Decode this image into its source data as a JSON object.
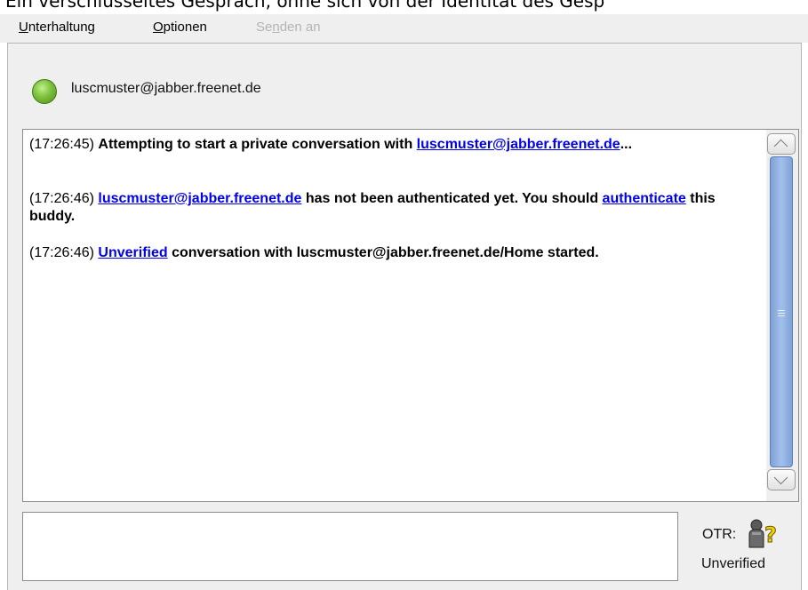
{
  "caption": "Ein verschlüsseltes Gespräch, ohne sich von der Identität des Gesp",
  "menu": [
    {
      "pre": "",
      "u": "U",
      "post": "nterhaltung"
    },
    {
      "pre": "",
      "u": "O",
      "post": "ptionen"
    },
    {
      "pre": "Se",
      "u": "n",
      "post": "den an"
    }
  ],
  "contact": {
    "name": "luscmuster@jabber.freenet.de",
    "status_color": "#7cc03c"
  },
  "messages": [
    {
      "time": "(17:26:45)",
      "text_before": "Attempting to start a private conversation with",
      "link": "luscmuster@jabber.freenet.de",
      "text_after": "..."
    },
    {
      "time": "(17:26:46)",
      "link": "luscmuster@jabber.freenet.de",
      "text_middle": "has not been authenticated yet.  You should",
      "link2": "authenticate",
      "text_after": "this buddy."
    },
    {
      "time": "(17:26:46)",
      "link": "Unverified",
      "text_after": "conversation with luscmuster@jabber.freenet.de/Home started."
    }
  ],
  "otr": {
    "label": "OTR:",
    "status": "Unverified",
    "icon": "otr-unverified-icon"
  },
  "colors": {
    "link": "#0000ee",
    "scroll_thumb": "#a3c0ec",
    "panel_bg": "#efefef"
  }
}
